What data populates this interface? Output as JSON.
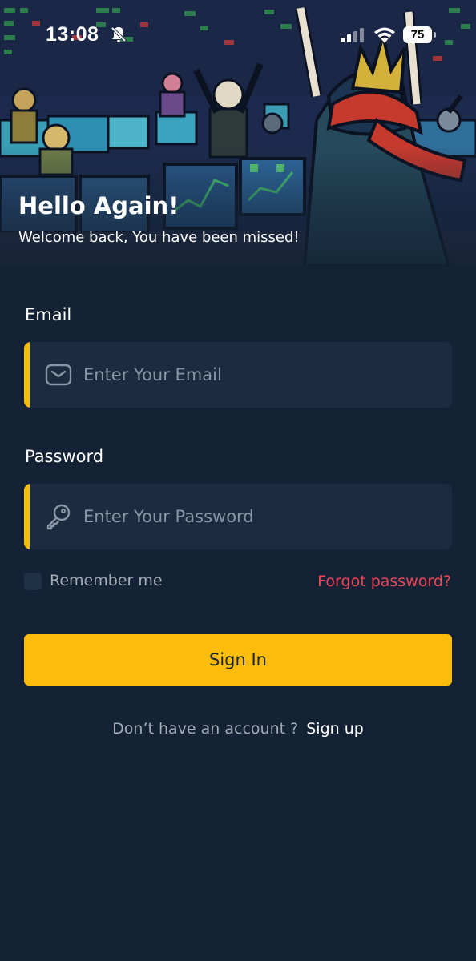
{
  "status_bar": {
    "time": "13:08",
    "battery": "75",
    "icons": [
      "bell-slash-icon",
      "cellular-signal-icon",
      "wifi-icon",
      "battery-icon"
    ]
  },
  "hero": {
    "title": "Hello Again!",
    "subtitle": "Welcome back, You have been missed!",
    "illustration": "trading-floor-celebration-illustration"
  },
  "form": {
    "email": {
      "label": "Email",
      "placeholder": "Enter Your Email",
      "value": "",
      "icon": "envelope-icon"
    },
    "password": {
      "label": "Password",
      "placeholder": "Enter Your Password",
      "value": "",
      "icon": "key-icon"
    },
    "remember_me": {
      "label": "Remember me",
      "checked": false
    },
    "forgot_password": "Forgot password?",
    "submit_label": "Sign In"
  },
  "footer": {
    "prompt": "Don’t have an account ?",
    "signup_label": "Sign up"
  },
  "colors": {
    "background": "#132234",
    "input_background": "#1b2c40",
    "accent": "#fbbd09",
    "link_red": "#f04659",
    "muted_text": "#a3acb8",
    "placeholder": "#8a96a6"
  }
}
